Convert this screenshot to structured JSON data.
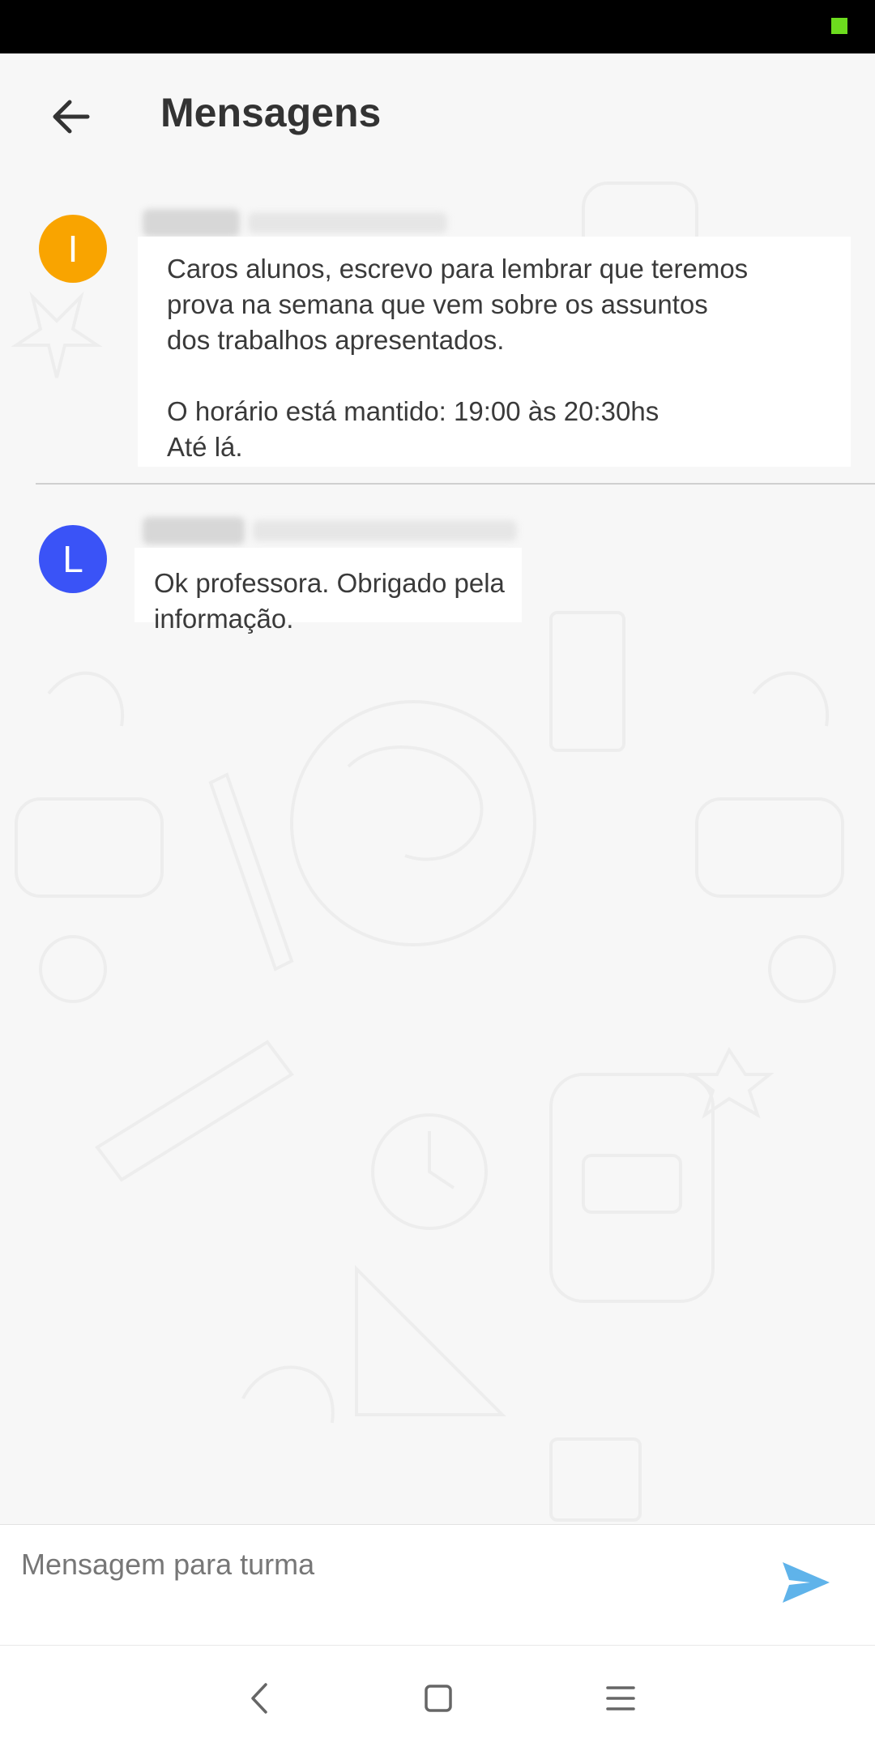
{
  "app": {
    "title": "Mensagens"
  },
  "colors": {
    "avatar_orange": "#f9a400",
    "avatar_blue": "#3a53f7",
    "send_icon": "#5fb3ea"
  },
  "messages": [
    {
      "avatar_letter": "I",
      "sender": "",
      "text": "Caros alunos, escrevo para lembrar que teremos\nprova na semana que vem sobre os assuntos\ndos trabalhos apresentados.\n\nO horário está mantido: 19:00 às 20:30hs\nAté lá."
    },
    {
      "avatar_letter": "L",
      "sender": "",
      "text": "Ok professora. Obrigado pela informação."
    }
  ],
  "composer": {
    "placeholder": "Mensagem para turma"
  },
  "icons": {
    "back": "arrow-left-icon",
    "send": "send-icon",
    "nav_back": "chevron-left-icon",
    "nav_home": "square-icon",
    "nav_menu": "menu-icon"
  }
}
